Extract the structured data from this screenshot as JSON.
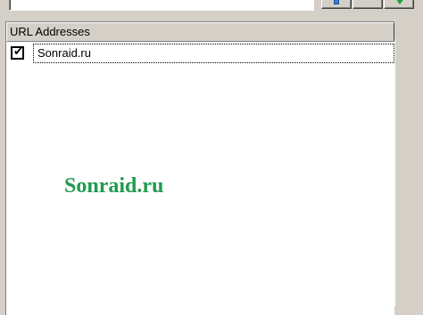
{
  "toolbar": {
    "url_value": "",
    "info_icon": "info-icon",
    "blank_button_icon": "blank-icon",
    "down_icon": "down-arrow-icon"
  },
  "list": {
    "column_header": "URL Addresses",
    "rows": [
      {
        "checked": true,
        "check_glyph": "✔",
        "url": "Sonraid.ru"
      }
    ]
  },
  "watermark": {
    "text": "Sonraid.ru",
    "color": "#1f9a4e"
  }
}
